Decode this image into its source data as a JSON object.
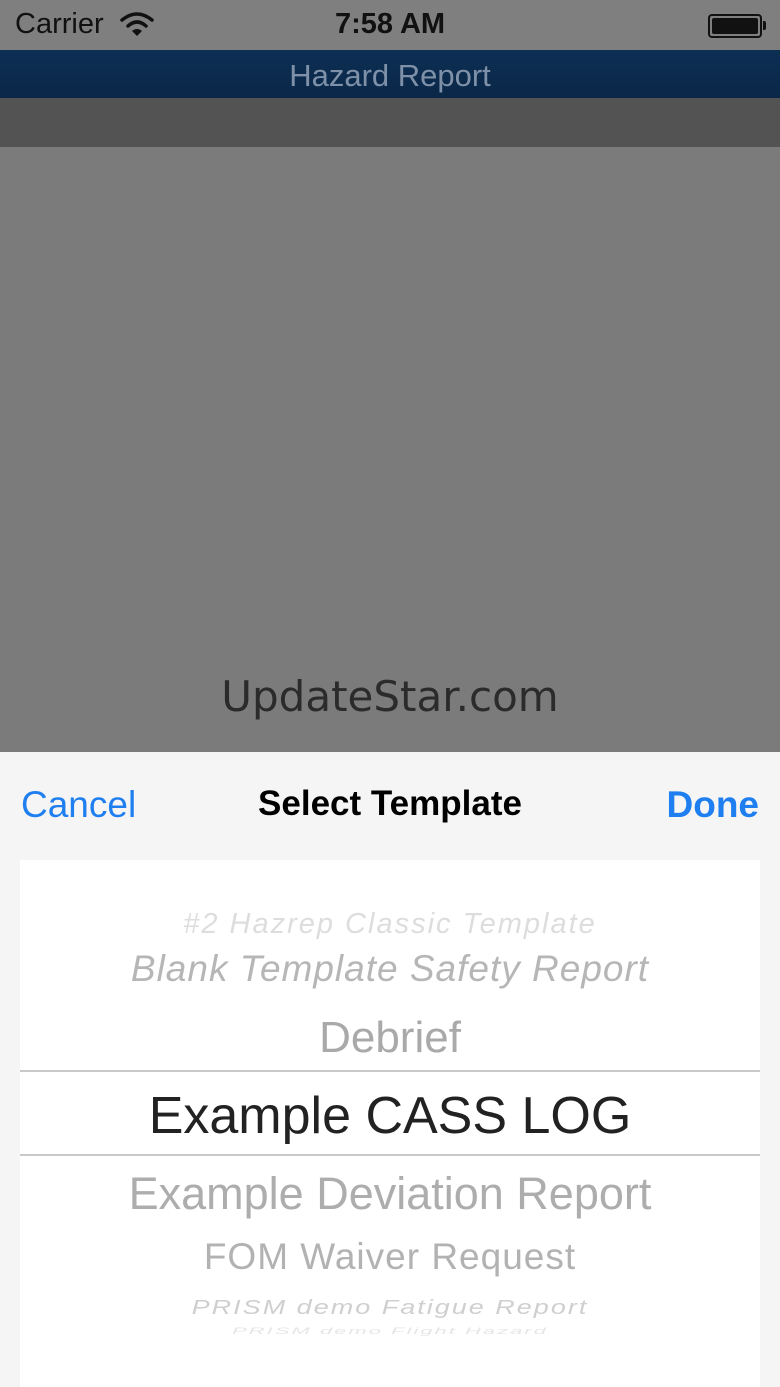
{
  "status_bar": {
    "carrier": "Carrier",
    "time": "7:58 AM",
    "icons": [
      "wifi-icon",
      "battery-icon"
    ]
  },
  "nav_bar": {
    "title": "Hazard Report"
  },
  "watermark": "UpdateStar.com",
  "template_sheet": {
    "cancel_label": "Cancel",
    "title": "Select Template",
    "done_label": "Done",
    "picker": {
      "items": [
        "#2 Hazrep Classic Template",
        "Blank Template Safety Report",
        "Debrief",
        "Example CASS LOG",
        "Example Deviation Report",
        "FOM Waiver Request",
        "PRISM demo Fatigue Report",
        "PRISM demo Flight Hazard"
      ],
      "selected": "Example CASS LOG"
    }
  },
  "colors": {
    "accent": "#1f7ff0",
    "nav_bar": "#0d2f54",
    "dim_overlay": "#7b7b7b"
  }
}
